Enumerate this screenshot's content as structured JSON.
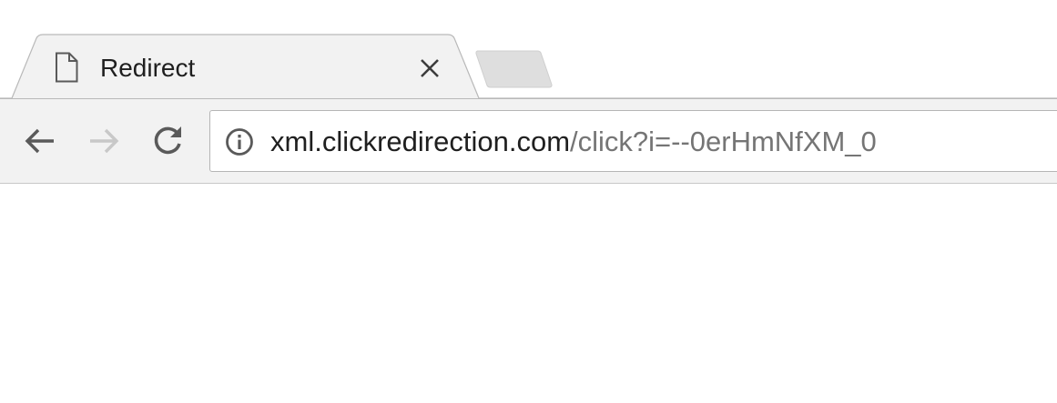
{
  "tab": {
    "title": "Redirect",
    "favicon": "document-icon",
    "close_icon": "close-icon"
  },
  "new_tab": {
    "icon": "new-tab-icon"
  },
  "toolbar": {
    "back_icon": "arrow-left-icon",
    "forward_icon": "arrow-right-icon",
    "forward_enabled": false,
    "reload_icon": "reload-icon"
  },
  "omnibox": {
    "security_icon": "info-icon",
    "url_host": "xml.clickredirection.com",
    "url_path": "/click?i=--0erHmNfXM_0"
  },
  "colors": {
    "toolbar_bg": "#f2f2f2",
    "tab_bg": "#f2f2f2",
    "url_host": "#1f1f1f",
    "url_path": "#757575",
    "icon": "#5a5a5a",
    "icon_disabled": "#c8c8c8"
  }
}
